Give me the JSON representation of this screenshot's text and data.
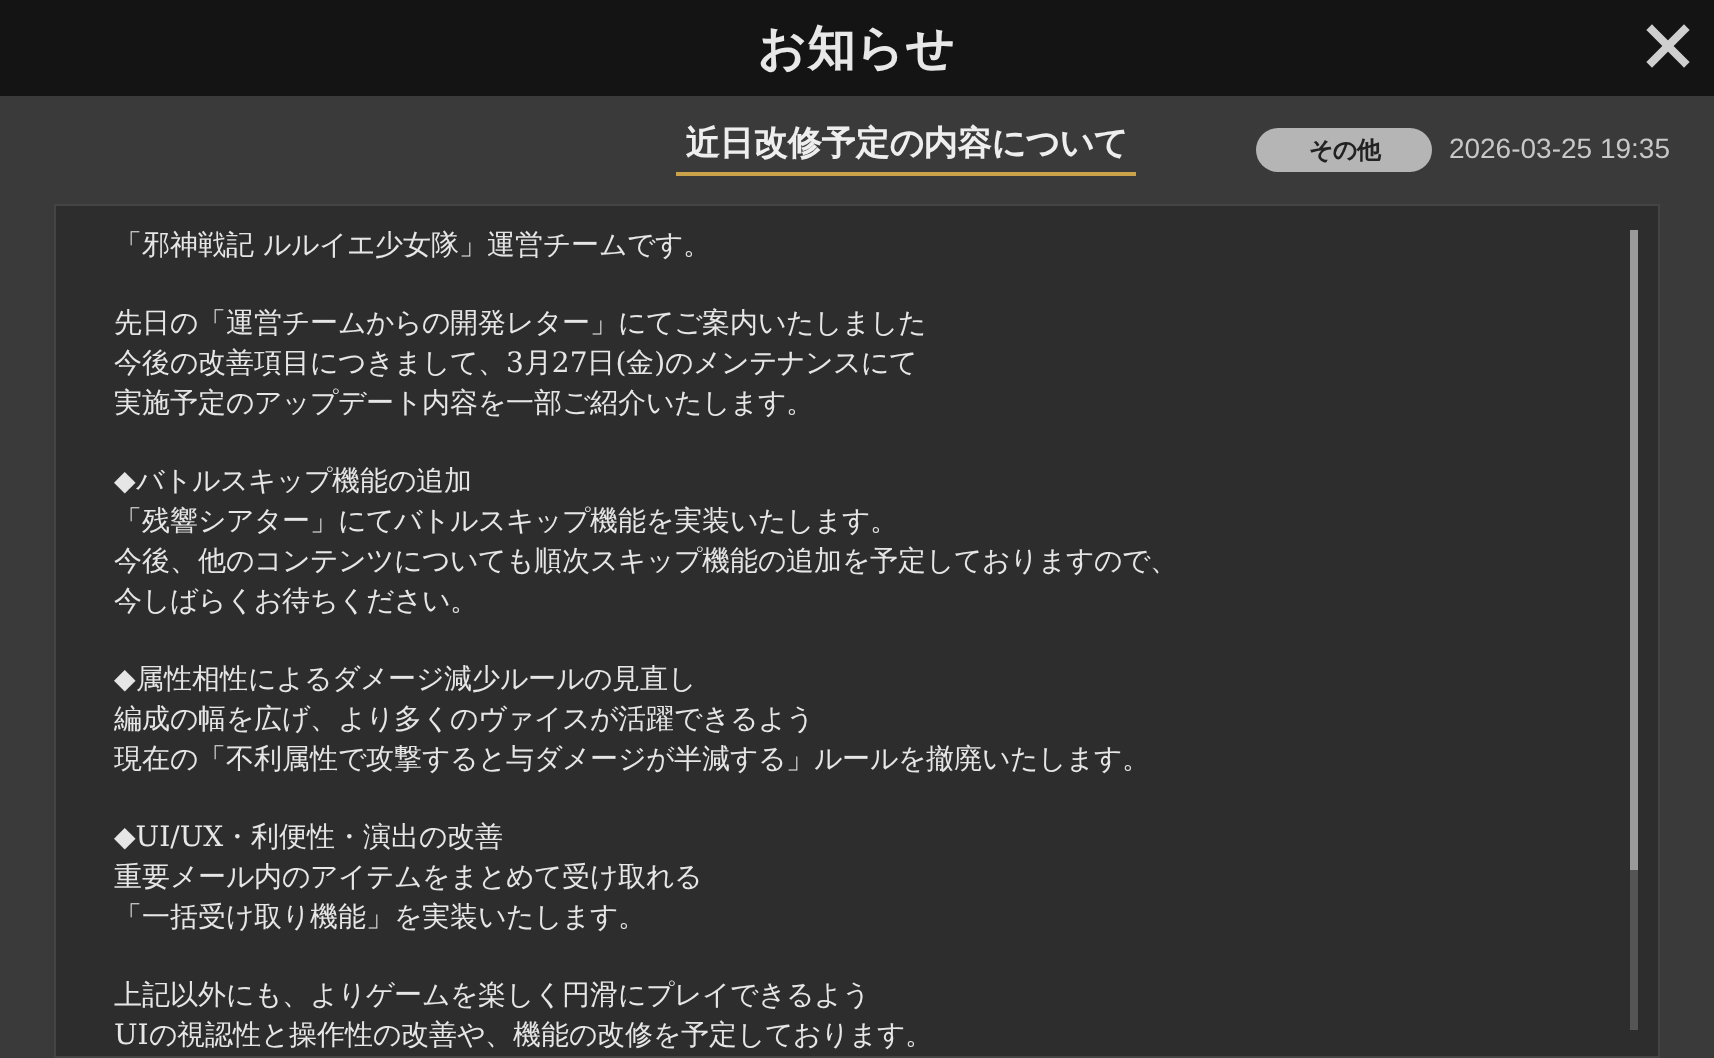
{
  "window": {
    "title": "お知らせ"
  },
  "article": {
    "title": "近日改修予定の内容について",
    "tag": "その他",
    "date": "2026-03-25 19:35",
    "paragraphs": [
      [
        "「邪神戦記 ルルイエ少女隊」運営チームです。"
      ],
      [
        "先日の「運営チームからの開発レター」にてご案内いたしました",
        "今後の改善項目につきまして、3月27日(金)のメンテナンスにて",
        "実施予定のアップデート内容を一部ご紹介いたします。"
      ],
      [
        "◆バトルスキップ機能の追加",
        "「残響シアター」にてバトルスキップ機能を実装いたします。",
        "今後、他のコンテンツについても順次スキップ機能の追加を予定しておりますので、",
        "今しばらくお待ちください。"
      ],
      [
        "◆属性相性によるダメージ減少ルールの見直し",
        "編成の幅を広げ、より多くのヴァイスが活躍できるよう",
        "現在の「不利属性で攻撃すると与ダメージが半減する」ルールを撤廃いたします。"
      ],
      [
        "◆UI/UX・利便性・演出の改善",
        "重要メール内のアイテムをまとめて受け取れる",
        "「一括受け取り機能」を実装いたします。"
      ],
      [
        "上記以外にも、よりゲームを楽しく円滑にプレイできるよう",
        "UIの視認性と操作性の改善や、機能の改修を予定しております。"
      ]
    ]
  }
}
